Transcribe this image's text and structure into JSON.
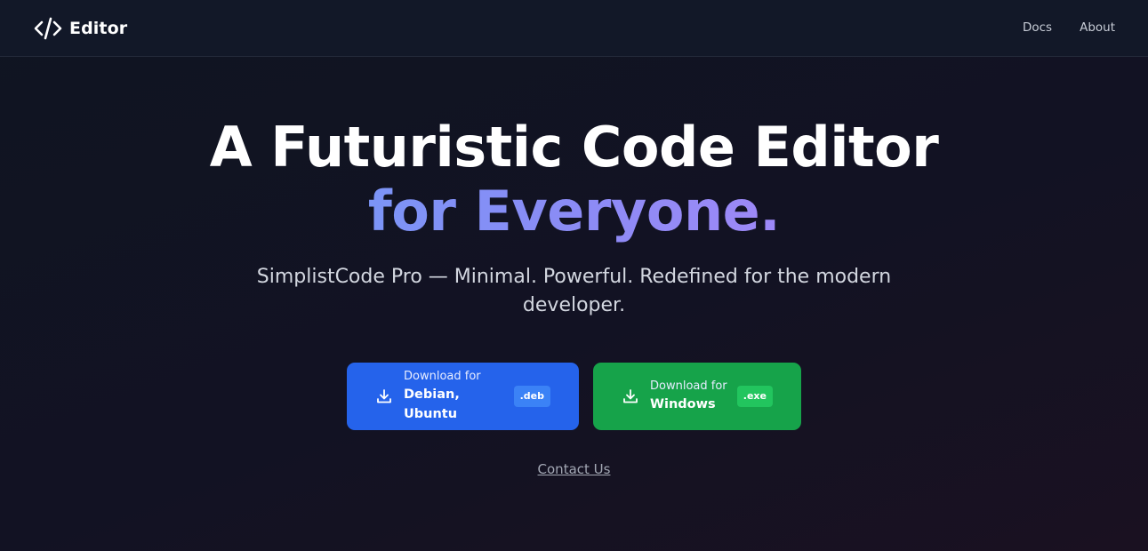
{
  "navbar": {
    "brand_name": "Editor",
    "brand_icon": "code-icon",
    "links": [
      {
        "label": "Docs"
      },
      {
        "label": "About"
      }
    ]
  },
  "hero": {
    "title_line1": "A Futuristic Code Editor",
    "title_line2": "for Everyone.",
    "subtitle": "SimplistCode Pro — Minimal. Powerful. Redefined for the modern developer."
  },
  "downloads": [
    {
      "label_small": "Download for",
      "label_big": "Debian, Ubuntu",
      "badge": ".deb",
      "icon": "download-icon",
      "color": "#2563eb"
    },
    {
      "label_small": "Download for",
      "label_big": "Windows",
      "badge": ".exe",
      "icon": "download-icon",
      "color": "#16a34a"
    }
  ],
  "contact_label": "Contact Us",
  "colors": {
    "background": "#121223",
    "navbar": "#121828",
    "gradient_start": "#60a5fa",
    "gradient_end": "#c084fc"
  }
}
